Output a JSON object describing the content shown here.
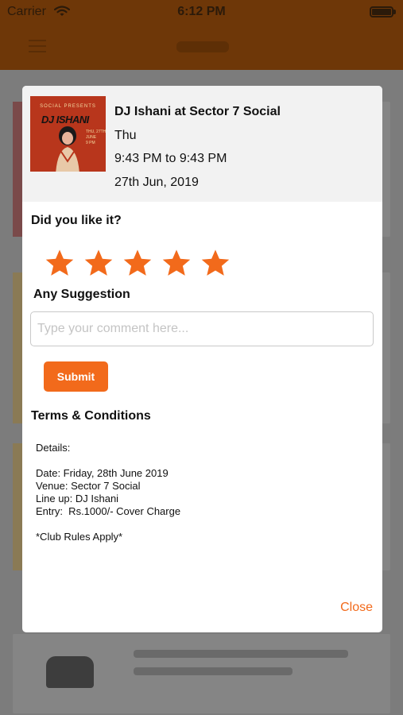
{
  "status_bar": {
    "carrier": "Carrier",
    "time": "6:12 PM",
    "icons": [
      "wifi-icon",
      "battery-icon"
    ]
  },
  "colors": {
    "accent": "#f26a1b",
    "header_dimmed": "#6e3708",
    "star": "#f26a1b",
    "overlay": "#7c7c7c"
  },
  "event": {
    "title": "DJ Ishani at Sector 7 Social",
    "day": "Thu",
    "time_range": "9:43 PM to 9:43 PM",
    "date": "27th Jun, 2019",
    "poster": {
      "subtitle": "SOCIAL PRESENTS",
      "title": "DJ ISHANI",
      "date_text": "THU, 27TH\nJUNE\n9 PM"
    }
  },
  "rating": {
    "question": "Did you like it?",
    "value": 5,
    "max": 5
  },
  "suggestion": {
    "label": "Any Suggestion",
    "placeholder": "Type your comment here...",
    "value": ""
  },
  "submit_label": "Submit",
  "terms": {
    "title": "Terms & Conditions",
    "lines": [
      "Details:",
      "",
      "Date: Friday, 28th June 2019",
      "Venue: Sector 7 Social",
      "Line up: DJ Ishani",
      "Entry:  Rs.1000/- Cover Charge",
      "",
      "*Club Rules Apply*"
    ]
  },
  "close_label": "Close"
}
